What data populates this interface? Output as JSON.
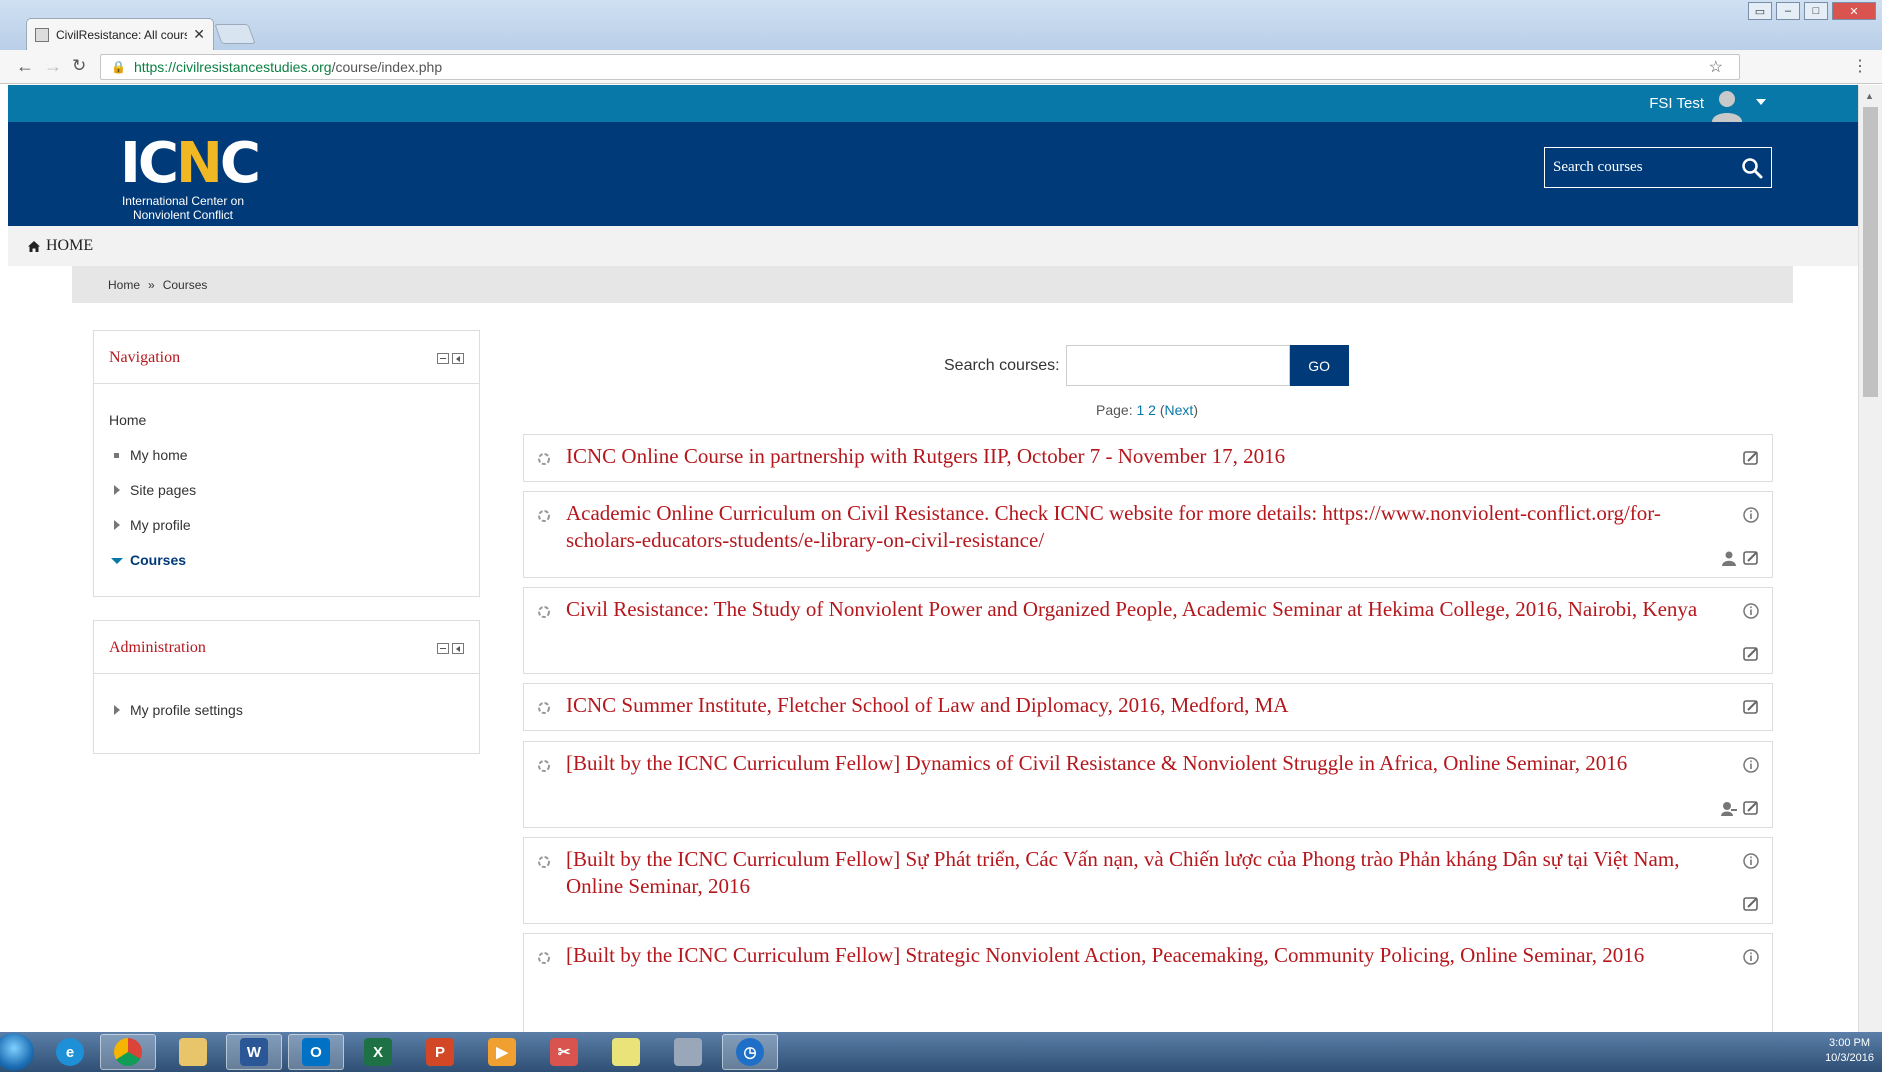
{
  "browser": {
    "tab_title": "CivilResistance: All courses",
    "url_host": "https://civilresistancestudies.org",
    "url_path": "/course/index.php"
  },
  "userbar": {
    "username": "FSI Test"
  },
  "header": {
    "logo_text_a": "IC",
    "logo_text_n": "N",
    "logo_text_c": "C",
    "logo_sub_1": "International Center on",
    "logo_sub_2": "Nonviolent Conflict",
    "search_placeholder": "Search courses"
  },
  "menu": {
    "home": "HOME"
  },
  "breadcrumb": {
    "home": "Home",
    "sep": "»",
    "current": "Courses"
  },
  "navigation_block": {
    "title": "Navigation",
    "items": [
      {
        "label": "Home"
      },
      {
        "label": "My home"
      },
      {
        "label": "Site pages"
      },
      {
        "label": "My profile"
      },
      {
        "label": "Courses"
      }
    ]
  },
  "administration_block": {
    "title": "Administration",
    "items": [
      {
        "label": "My profile settings"
      }
    ]
  },
  "course_search": {
    "label": "Search courses:",
    "button": "GO"
  },
  "paging": {
    "prefix": "Page:",
    "p1": "1",
    "p2": "2",
    "next": "Next"
  },
  "courses": [
    {
      "title": "ICNC Online Course in partnership with Rutgers IIP, October 7 - November 17, 2016"
    },
    {
      "title": "Academic Online Curriculum on Civil Resistance. Check ICNC website for more details: https://www.nonviolent-conflict.org/for-scholars-educators-students/e-library-on-civil-resistance/"
    },
    {
      "title": "Civil Resistance: The Study of Nonviolent Power and Organized People, Academic Seminar at Hekima College, 2016, Nairobi, Kenya"
    },
    {
      "title": "ICNC Summer Institute, Fletcher School of Law and Diplomacy, 2016, Medford, MA"
    },
    {
      "title": "[Built by the ICNC Curriculum Fellow] Dynamics of Civil Resistance & Nonviolent Struggle in Africa, Online Seminar, 2016"
    },
    {
      "title": "[Built by the ICNC Curriculum Fellow] Sự Phát triển, Các Vấn nạn, và Chiến lược của Phong trào Phản kháng Dân sự tại Việt Nam, Online Seminar, 2016"
    },
    {
      "title": "[Built by the ICNC Curriculum Fellow] Strategic Nonviolent Action, Peacemaking, Community Policing, Online Seminar, 2016"
    }
  ],
  "taskbar": {
    "time": "3:00 PM",
    "date": "10/3/2016"
  },
  "colors": {
    "brand_navy": "#003a78",
    "brand_blue": "#0878a8",
    "link_red": "#b5171d",
    "logo_gold": "#f1b825"
  }
}
